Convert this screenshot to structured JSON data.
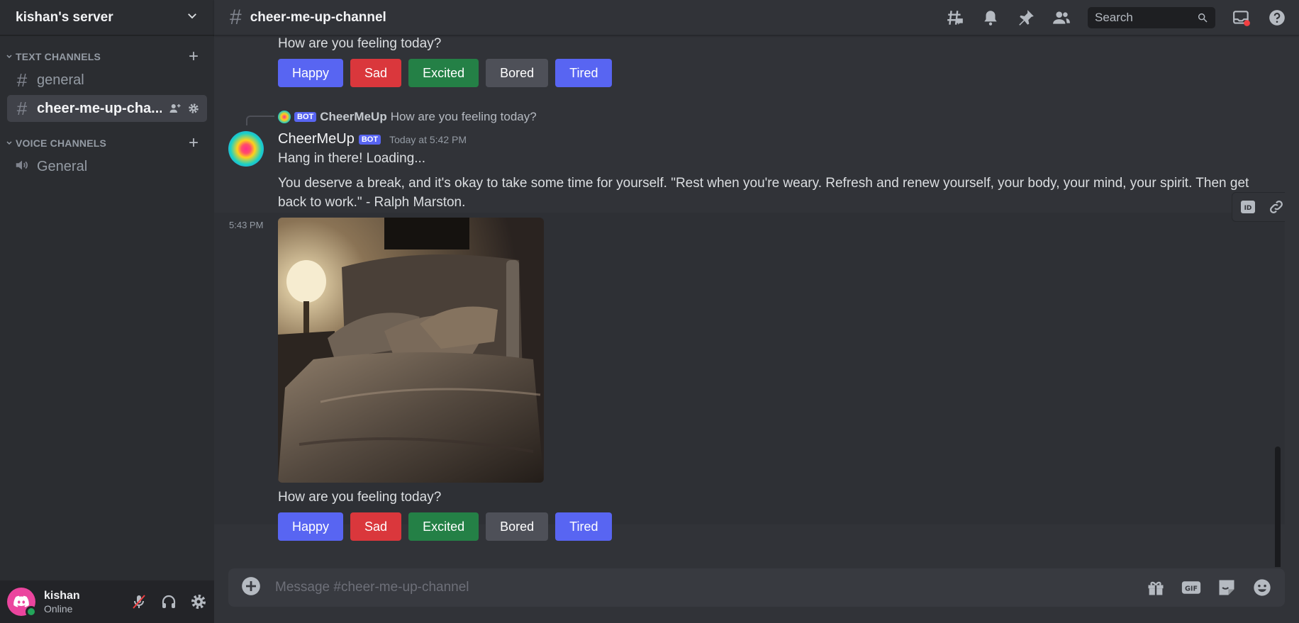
{
  "server": {
    "name": "kishan's server"
  },
  "categories": {
    "text": "TEXT CHANNELS",
    "voice": "VOICE CHANNELS"
  },
  "channels": {
    "text": [
      {
        "name": "general"
      },
      {
        "name": "cheer-me-up-cha..."
      }
    ],
    "voice": [
      {
        "name": "General"
      }
    ]
  },
  "user": {
    "name": "kishan",
    "status": "Online"
  },
  "topbar": {
    "channel_name": "cheer-me-up-channel",
    "search_placeholder": "Search"
  },
  "messages": {
    "top_prompt": "How are you feeling today?",
    "mood_buttons": [
      "Happy",
      "Sad",
      "Excited",
      "Bored",
      "Tired"
    ],
    "reply": {
      "bot_tag": "BOT",
      "author": "CheerMeUp",
      "text": "How are you feeling today?"
    },
    "main": {
      "author": "CheerMeUp",
      "bot_tag": "BOT",
      "timestamp": "Today at 5:42 PM",
      "line1": "Hang in there! Loading...",
      "paragraph": "You deserve a break, and it's okay to take some time for yourself. \"Rest when you're weary. Refresh and renew yourself, your body, your mind, your spirit. Then get back to work.\" - Ralph Marston."
    },
    "image_time": "5:43 PM",
    "bottom_prompt": "How are you feeling today?"
  },
  "composer": {
    "placeholder": "Message #cheer-me-up-channel",
    "gif_label": "GIF"
  },
  "colors": {
    "blurple": "#5865f2",
    "danger": "#da373c",
    "success": "#248046",
    "secondary": "#4e5058",
    "online": "#23a55a"
  }
}
